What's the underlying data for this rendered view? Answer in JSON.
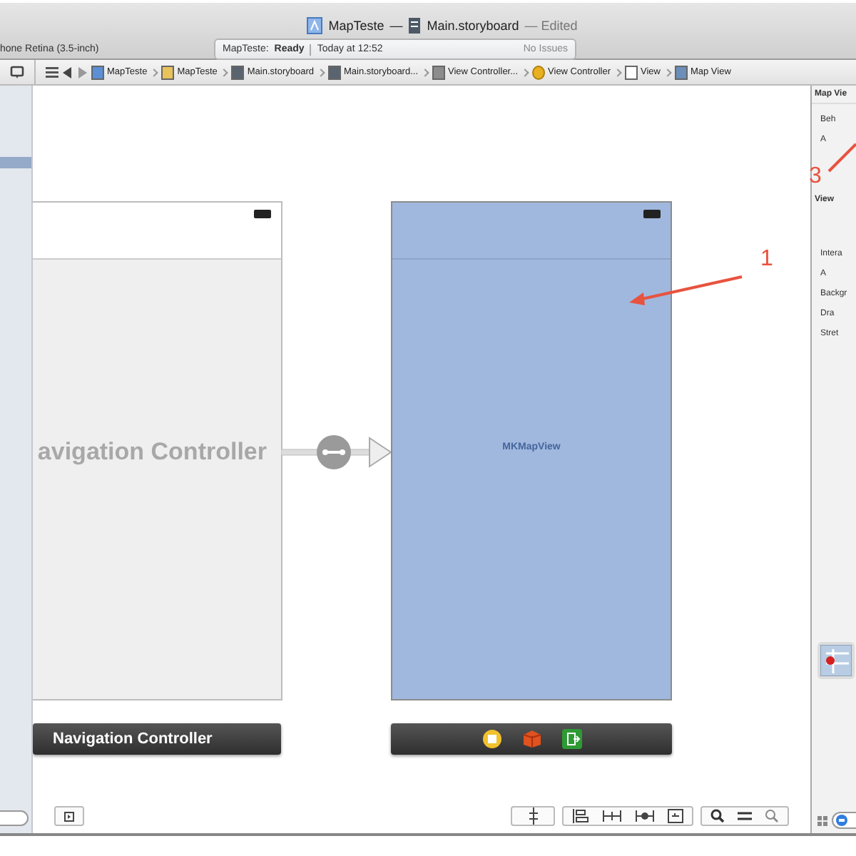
{
  "window": {
    "project": "MapTeste",
    "separator": "—",
    "file": "Main.storyboard",
    "status": "— Edited"
  },
  "toolbar": {
    "scheme": "hone Retina (3.5-inch)",
    "activity": {
      "project": "MapTeste:",
      "state": "Ready",
      "time": "Today at 12:52",
      "issues": "No Issues"
    }
  },
  "breadcrumbs": [
    {
      "label": "MapTeste",
      "kind": "project"
    },
    {
      "label": "MapTeste",
      "kind": "folder"
    },
    {
      "label": "Main.storyboard",
      "kind": "storyboard"
    },
    {
      "label": "Main.storyboard...",
      "kind": "storyboard"
    },
    {
      "label": "View Controller...",
      "kind": "scene"
    },
    {
      "label": "View Controller",
      "kind": "controller"
    },
    {
      "label": "View",
      "kind": "view"
    },
    {
      "label": "Map View",
      "kind": "mapview"
    }
  ],
  "canvas": {
    "scenes": [
      {
        "kind": "navigation",
        "title": "avigation Controller",
        "dock_label": "Navigation Controller"
      },
      {
        "kind": "map",
        "title": "MKMapView"
      }
    ],
    "annotations": [
      {
        "label": "1",
        "kind": "map"
      },
      {
        "label": "3",
        "kind": "inspector"
      }
    ]
  },
  "inspector": {
    "title": "Map Vie",
    "rows": [
      {
        "label": "Beh",
        "kind": "label"
      },
      {
        "label": "A",
        "kind": "label"
      },
      {
        "label": "View",
        "kind": "header"
      },
      {
        "label": "Intera",
        "kind": "label"
      },
      {
        "label": "A",
        "kind": "label"
      },
      {
        "label": "Backgr",
        "kind": "label"
      },
      {
        "label": "Dra",
        "kind": "label"
      },
      {
        "label": "Stret",
        "kind": "label"
      }
    ]
  }
}
